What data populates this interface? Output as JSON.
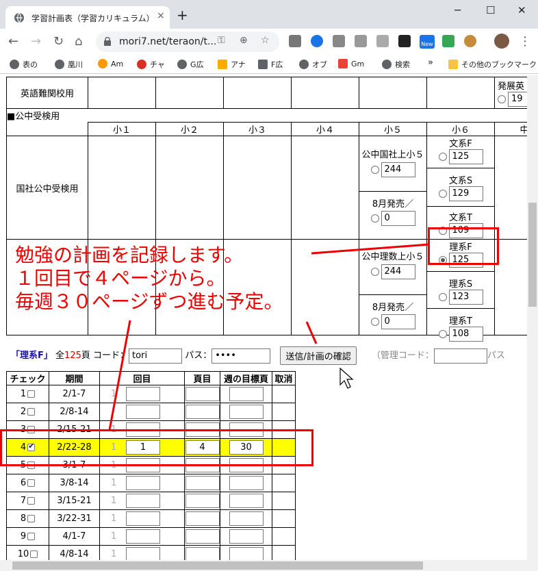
{
  "browser": {
    "tab_title": "学習計画表（学習カリキュラム）",
    "tab_close": "×",
    "new_tab": "+",
    "url": "mori7.net/teraon/t...",
    "new_badge": "New",
    "win_minimize": "─",
    "win_maximize": "☐",
    "win_close": "✕",
    "more_bookmarks": "»",
    "bookmarks": [
      {
        "label": "表の",
        "color": "#5f6368"
      },
      {
        "label": "凰川",
        "color": "#5f6368"
      },
      {
        "label": "Am",
        "color": "#ff9900"
      },
      {
        "label": "チャ",
        "color": "#d93025"
      },
      {
        "label": "G広",
        "color": "#5f6368"
      },
      {
        "label": "アナ",
        "color": "#f9ab00"
      },
      {
        "label": "F広",
        "color": "#5f6368"
      },
      {
        "label": "オブ",
        "color": "#5f6368"
      },
      {
        "label": "Gm",
        "color": "#ea4335"
      },
      {
        "label": "検索",
        "color": "#5f6368"
      }
    ],
    "other_bookmarks": "その他のブックマーク"
  },
  "curriculum": {
    "row_english_label": "英語難関校用",
    "row_english_partial": "発展英",
    "row_english_partial_value": "19",
    "section_header": "■公中受検用",
    "grade_headers": [
      "小１",
      "小２",
      "小３",
      "小４",
      "小５",
      "小６",
      "中"
    ],
    "row_social_label": "国社公中受検用",
    "social_g5": [
      {
        "label": "公中国社上小５",
        "value": "244"
      },
      {
        "label": "8月発売／",
        "value": "0"
      }
    ],
    "social_g6": [
      {
        "label": "文系F",
        "value": "125"
      },
      {
        "label": "文系S",
        "value": "129"
      },
      {
        "label": "文系T",
        "value": "109"
      }
    ],
    "math_g5": [
      {
        "label": "公中理数上小５",
        "value": "244"
      },
      {
        "label": "8月発売／",
        "value": "0"
      }
    ],
    "math_g6": [
      {
        "label": "理系F",
        "value": "125",
        "selected": true
      },
      {
        "label": "理系S",
        "value": "123"
      },
      {
        "label": "理系T",
        "value": "108"
      }
    ]
  },
  "annotation": {
    "line1": "勉強の計画を記録します。",
    "line2": "１回目で４ページから。",
    "line3": "毎週３０ページずつ進む予定。",
    "color": "#e00000"
  },
  "form": {
    "selected_label": "「理系F」",
    "total_prefix": "全",
    "total_pages": "125",
    "total_suffix": "頁",
    "code_label": "コード：",
    "code_value": "tori",
    "pass_label": "パス：",
    "pass_value": "••••",
    "submit_label": "送信/計画の確認",
    "admin_label": "（管理コード：",
    "admin_pass_label": "パス"
  },
  "schedule": {
    "headers": [
      "チェック",
      "期間",
      "回目",
      "頁目",
      "週の目標頁",
      "取消"
    ],
    "rows": [
      {
        "no": "1",
        "period": "2/1-7",
        "checked": false,
        "kai": "",
        "page": "",
        "goal": "",
        "faint": "1"
      },
      {
        "no": "2",
        "period": "2/8-14",
        "checked": false,
        "kai": "",
        "page": "",
        "goal": "",
        "faint": ""
      },
      {
        "no": "3",
        "period": "2/15-21",
        "checked": false,
        "kai": "",
        "page": "",
        "goal": "",
        "faint": "1"
      },
      {
        "no": "4",
        "period": "2/22-28",
        "checked": true,
        "kai": "1",
        "page": "4",
        "goal": "30",
        "faint": "1"
      },
      {
        "no": "5",
        "period": "3/1-7",
        "checked": false,
        "kai": "",
        "page": "",
        "goal": "",
        "faint": "1"
      },
      {
        "no": "6",
        "period": "3/8-14",
        "checked": false,
        "kai": "",
        "page": "",
        "goal": "",
        "faint": "1"
      },
      {
        "no": "7",
        "period": "3/15-21",
        "checked": false,
        "kai": "",
        "page": "",
        "goal": "",
        "faint": "1"
      },
      {
        "no": "8",
        "period": "3/22-31",
        "checked": false,
        "kai": "",
        "page": "",
        "goal": "",
        "faint": "1"
      },
      {
        "no": "9",
        "period": "4/1-7",
        "checked": false,
        "kai": "",
        "page": "",
        "goal": "",
        "faint": "1"
      },
      {
        "no": "10",
        "period": "4/8-14",
        "checked": false,
        "kai": "",
        "page": "",
        "goal": "",
        "faint": "1"
      }
    ]
  },
  "colors": {
    "highlight_row": "#ffff00",
    "annotation_red": "#e00000",
    "link_blue": "#1a0dab"
  }
}
